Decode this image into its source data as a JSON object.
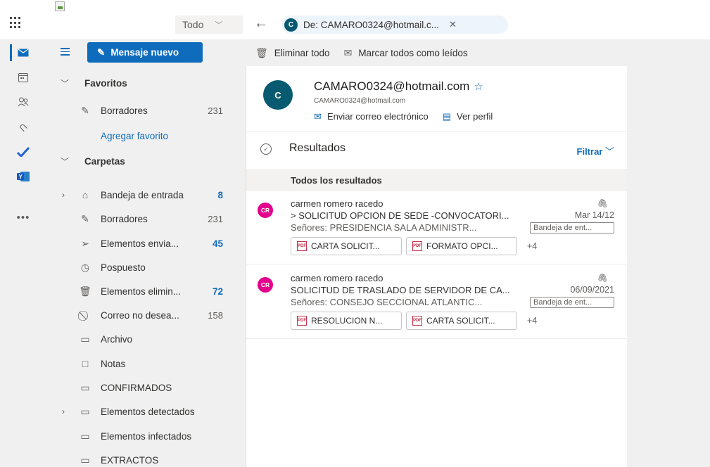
{
  "topbar": {
    "scope": "Todo",
    "chip_initial": "C",
    "chip_label": "De: CAMARO0324@hotmail.c..."
  },
  "rail": {
    "items": [
      "mail-icon",
      "calendar-icon",
      "people-icon",
      "attach-icon",
      "todo-icon",
      "excel-icon",
      "more-icon"
    ]
  },
  "toolbar": {
    "new_mail": "Mensaje nuevo",
    "delete_all": "Eliminar todo",
    "mark_read": "Marcar todos como leídos"
  },
  "folders": {
    "favorites": "Favoritos",
    "fav_drafts": {
      "label": "Borradores",
      "count": "231"
    },
    "add_favorite": "Agregar favorito",
    "folders_section": "Carpetas",
    "items": [
      {
        "label": "Bandeja de entrada",
        "count": "8",
        "blue": true
      },
      {
        "label": "Borradores",
        "count": "231",
        "blue": false
      },
      {
        "label": "Elementos envia...",
        "count": "45",
        "blue": true
      },
      {
        "label": "Pospuesto",
        "count": "",
        "blue": false
      },
      {
        "label": "Elementos elimin...",
        "count": "72",
        "blue": true
      },
      {
        "label": "Correo no desea...",
        "count": "158",
        "blue": false
      },
      {
        "label": "Archivo",
        "count": "",
        "blue": false
      },
      {
        "label": "Notas",
        "count": "",
        "blue": false
      },
      {
        "label": "CONFIRMADOS",
        "count": "",
        "blue": false
      },
      {
        "label": "Elementos detectados",
        "count": "",
        "blue": false
      },
      {
        "label": "Elementos infectados",
        "count": "",
        "blue": false
      },
      {
        "label": "EXTRACTOS",
        "count": "",
        "blue": false
      }
    ]
  },
  "contact": {
    "initial": "C",
    "name": "CAMARO0324@hotmail.com",
    "email": "CAMARO0324@hotmail.com",
    "send_email": "Enviar correo electrónico",
    "view_profile": "Ver perfil"
  },
  "results": {
    "title": "Resultados",
    "filter": "Filtrar",
    "all_results": "Todos los resultados"
  },
  "messages": [
    {
      "initials": "CR",
      "from": "carmen romero racedo",
      "subject": "> SOLICITUD OPCION DE SEDE -CONVOCATORI...",
      "date": "Mar 14/12",
      "preview": "Señores: PRESIDENCIA SALA ADMINISTR...",
      "folder": "Bandeja de ent...",
      "attachments": [
        "CARTA SOLICIT...",
        "FORMATO OPCI..."
      ],
      "more": "+4"
    },
    {
      "initials": "CR",
      "from": "carmen romero racedo",
      "subject": "SOLICITUD DE TRASLADO DE SERVIDOR DE CA...",
      "date": "06/09/2021",
      "preview": "Señores: CONSEJO SECCIONAL ATLANTIC...",
      "folder": "Bandeja de ent...",
      "attachments": [
        "RESOLUCION N...",
        "CARTA SOLICIT..."
      ],
      "more": "+4"
    }
  ],
  "colors": {
    "accent": "#0f6cbd",
    "avatar_teal": "#075a6f",
    "avatar_pink": "#e3008c",
    "pane_bg": "#f0f0f0"
  }
}
